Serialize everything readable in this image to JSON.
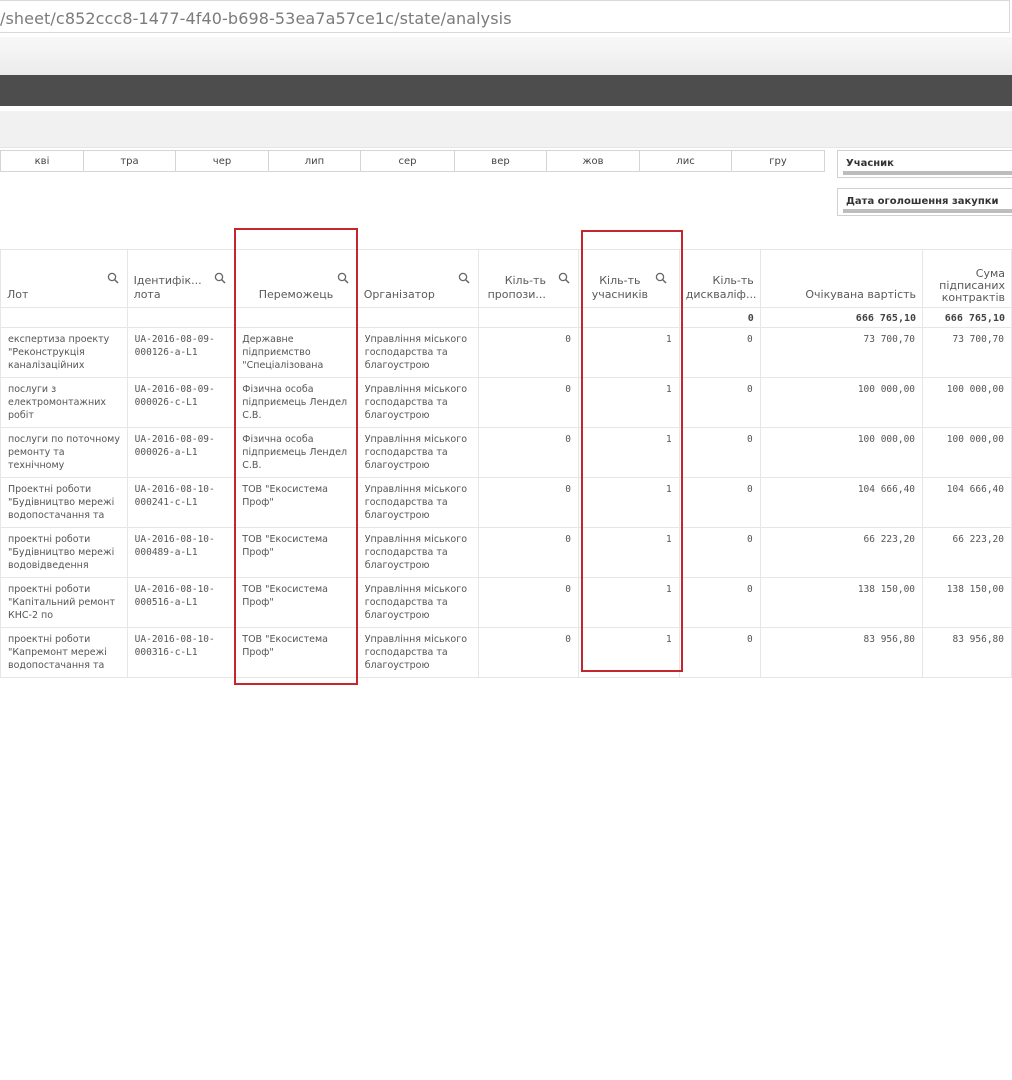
{
  "address_bar": {
    "url": "/sheet/c852ccc8-1477-4f40-b698-53ea7a57ce1c/state/analysis"
  },
  "months": [
    "кві",
    "тра",
    "чер",
    "лип",
    "сер",
    "вер",
    "жов",
    "лис",
    "гру"
  ],
  "filters": [
    {
      "label": "Учасник"
    },
    {
      "label": "Дата оголошення закупки"
    }
  ],
  "table": {
    "columns": {
      "lot": "Лот",
      "lot_id": "Ідентифік... лота",
      "winner": "Переможець",
      "organizer": "Організатор",
      "proposals": "Кіль-ть пропози...",
      "participants": "Кіль-ть учасників",
      "disqualified": "Кіль-ть дискваліф...",
      "expected_value": "Очікувана вартість",
      "signed_sum": "Сума підписаних контрактів"
    },
    "totals": {
      "disqualified": "0",
      "expected_value": "666 765,10",
      "signed_sum": "666 765,10"
    },
    "rows": [
      {
        "lot": "експертиза проекту \"Реконструкція каналізаційних",
        "lot_id": "UA-2016-08-09-000126-a-L1",
        "winner": "Державне підприємство \"Спеціалізована",
        "organizer": "Управління міського господарства та благоустрою",
        "proposals": "0",
        "participants": "1",
        "disqualified": "0",
        "expected_value": "73 700,70",
        "signed_sum": "73 700,70"
      },
      {
        "lot": "послуги з електромонтажних робіт",
        "lot_id": "UA-2016-08-09-000026-c-L1",
        "winner": "Фізична особа підприємець Лендел С.В.",
        "organizer": "Управління міського господарства та благоустрою",
        "proposals": "0",
        "participants": "1",
        "disqualified": "0",
        "expected_value": "100 000,00",
        "signed_sum": "100 000,00"
      },
      {
        "lot": "послуги по поточному ремонту та технічному",
        "lot_id": "UA-2016-08-09-000026-a-L1",
        "winner": "Фізична особа підприємець Лендел С.В.",
        "organizer": "Управління міського господарства та благоустрою",
        "proposals": "0",
        "participants": "1",
        "disqualified": "0",
        "expected_value": "100 000,00",
        "signed_sum": "100 000,00"
      },
      {
        "lot": "Проектні роботи \"Будівництво мережі водопостачання та",
        "lot_id": "UA-2016-08-10-000241-c-L1",
        "winner": "ТОВ \"Екосистема Проф\"",
        "organizer": "Управління міського господарства та благоустрою",
        "proposals": "0",
        "participants": "1",
        "disqualified": "0",
        "expected_value": "104 666,40",
        "signed_sum": "104 666,40"
      },
      {
        "lot": "проектні роботи \"Будівництво мережі водовідведення",
        "lot_id": "UA-2016-08-10-000489-a-L1",
        "winner": "ТОВ \"Екосистема Проф\"",
        "organizer": "Управління міського господарства та благоустрою",
        "proposals": "0",
        "participants": "1",
        "disqualified": "0",
        "expected_value": "66 223,20",
        "signed_sum": "66 223,20"
      },
      {
        "lot": "проектні роботи \"Капітальний ремонт КНС-2 по",
        "lot_id": "UA-2016-08-10-000516-a-L1",
        "winner": "ТОВ \"Екосистема Проф\"",
        "organizer": "Управління міського господарства та благоустрою",
        "proposals": "0",
        "participants": "1",
        "disqualified": "0",
        "expected_value": "138 150,00",
        "signed_sum": "138 150,00"
      },
      {
        "lot": "проектні роботи \"Капремонт мережі водопостачання та",
        "lot_id": "UA-2016-08-10-000316-c-L1",
        "winner": "ТОВ \"Екосистема Проф\"",
        "organizer": "Управління міського господарства та благоустрою",
        "proposals": "0",
        "participants": "1",
        "disqualified": "0",
        "expected_value": "83 956,80",
        "signed_sum": "83 956,80"
      }
    ]
  },
  "colors": {
    "highlight": "#c3272e",
    "dark_bar": "#4d4d4d"
  },
  "icons": {
    "column_search": "search-icon"
  }
}
